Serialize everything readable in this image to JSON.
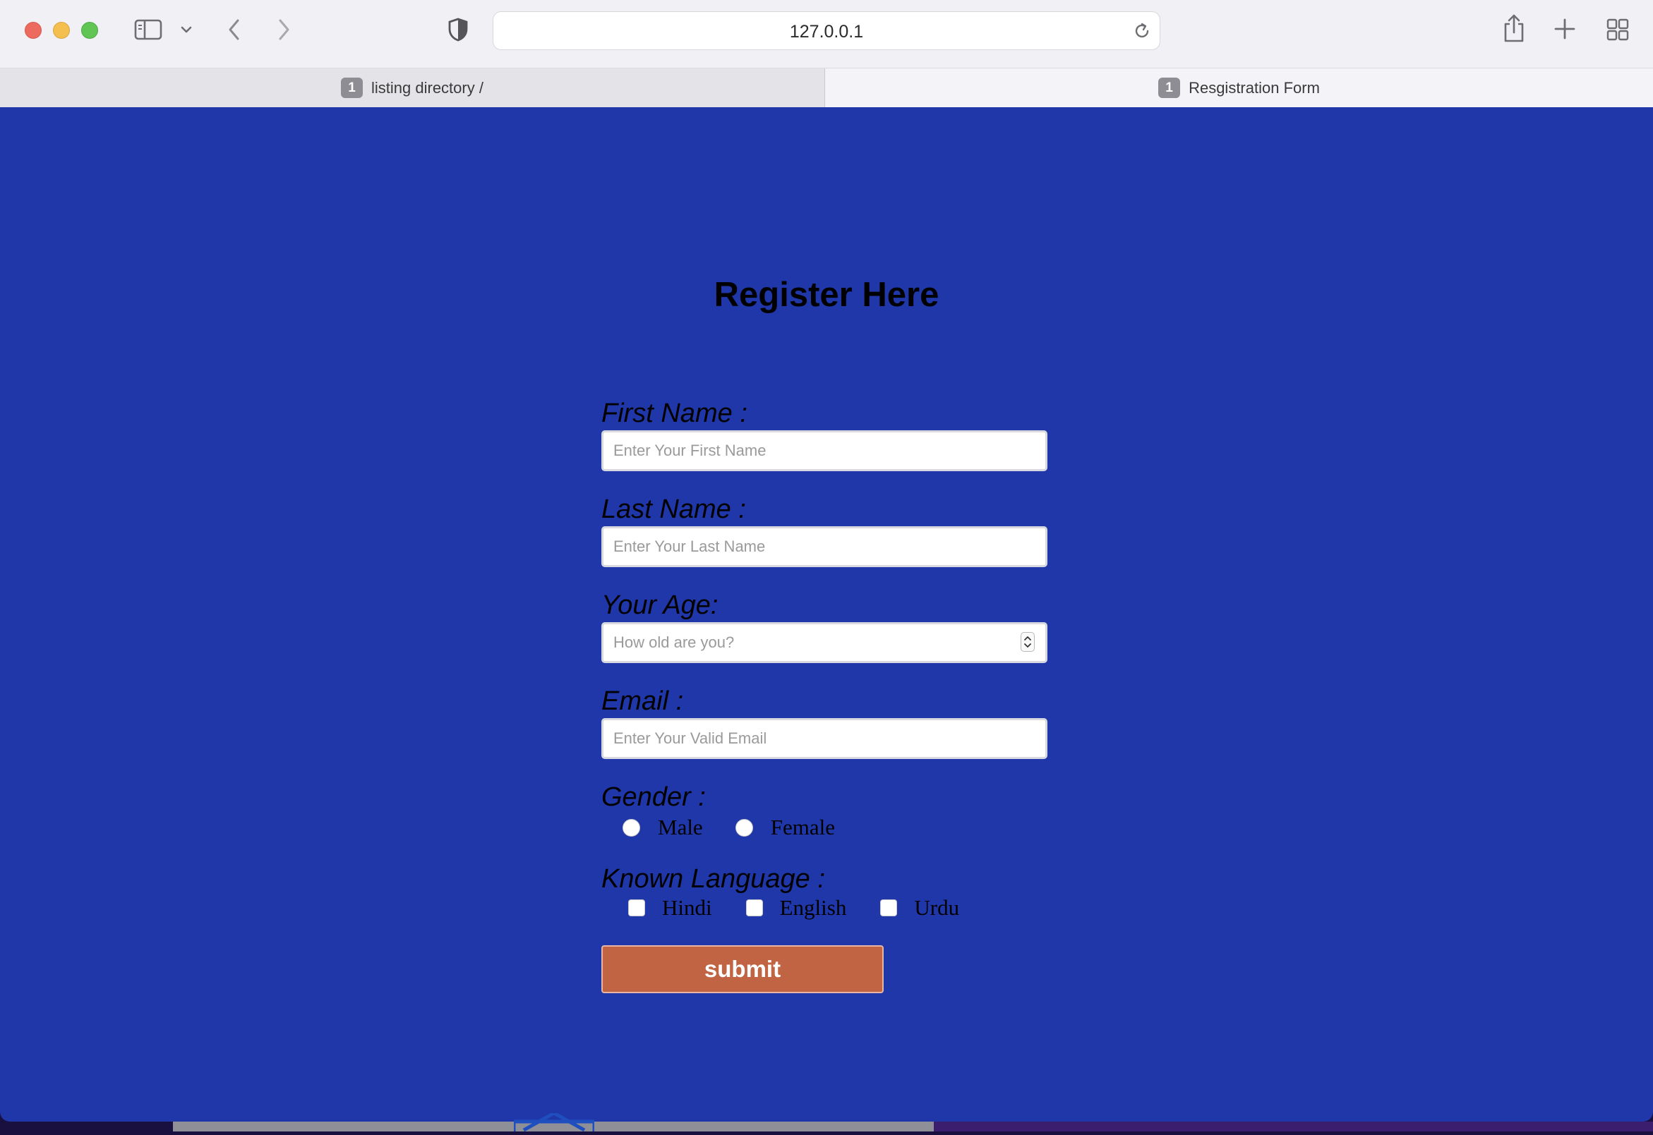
{
  "browser": {
    "url": "127.0.0.1",
    "tabs": [
      {
        "badge": "1",
        "label": "listing directory /",
        "active": false
      },
      {
        "badge": "1",
        "label": "Resgistration Form",
        "active": true
      }
    ],
    "icons": [
      "sidebar-icon",
      "chevron-down-icon",
      "back-icon",
      "forward-icon",
      "privacy-shield-icon",
      "reload-icon",
      "share-icon",
      "new-tab-icon",
      "tab-overview-icon"
    ]
  },
  "form": {
    "title": "Register Here",
    "first_name": {
      "label": "First Name :",
      "placeholder": "Enter Your First Name"
    },
    "last_name": {
      "label": "Last Name :",
      "placeholder": "Enter Your Last Name"
    },
    "age": {
      "label": "Your Age:",
      "placeholder": "How old are you?"
    },
    "email": {
      "label": "Email :",
      "placeholder": "Enter Your Valid Email"
    },
    "gender": {
      "label": "Gender :",
      "options": [
        "Male",
        "Female"
      ]
    },
    "languages": {
      "label": "Known Language :",
      "options": [
        "Hindi",
        "English",
        "Urdu"
      ]
    },
    "submit_label": "submit"
  },
  "colors": {
    "page_background": "#1f37a8",
    "submit_button": "#c16444",
    "toolbar": "#f1f0f5"
  }
}
